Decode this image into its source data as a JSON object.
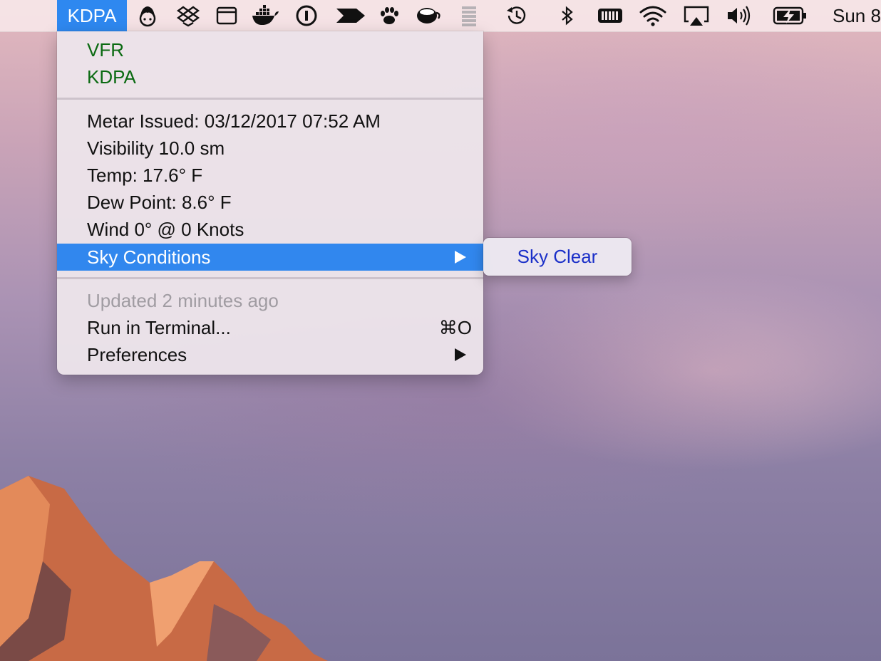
{
  "menubar": {
    "app_title": "KDPA",
    "clock": "Sun 8",
    "status_icons": [
      "character-icon",
      "dropbox-icon",
      "window-icon",
      "docker-icon",
      "onepassword-icon",
      "arrow-icon",
      "paw-icon",
      "coffee-icon",
      "stack-icon",
      "time-machine-icon",
      "bluetooth-icon",
      "battery-monitor-icon",
      "wifi-icon",
      "airplay-icon",
      "volume-icon",
      "battery-charging-icon"
    ]
  },
  "menu": {
    "flight_rule": "VFR",
    "station": "KDPA",
    "metar_issued": "Metar Issued: 03/12/2017 07:52 AM",
    "visibility": "Visibility 10.0 sm",
    "temp": "Temp: 17.6° F",
    "dew_point": "Dew Point: 8.6° F",
    "wind": "Wind 0° @ 0 Knots",
    "sky_conditions": "Sky Conditions",
    "updated": "Updated 2 minutes ago",
    "run_in_terminal": "Run in Terminal...",
    "run_shortcut": "⌘O",
    "preferences": "Preferences"
  },
  "submenu": {
    "sky_clear": "Sky Clear"
  },
  "colors": {
    "highlight": "#3187ee",
    "flight_rule_green": "#0b6a12",
    "submenu_text": "#1a2fc8"
  }
}
